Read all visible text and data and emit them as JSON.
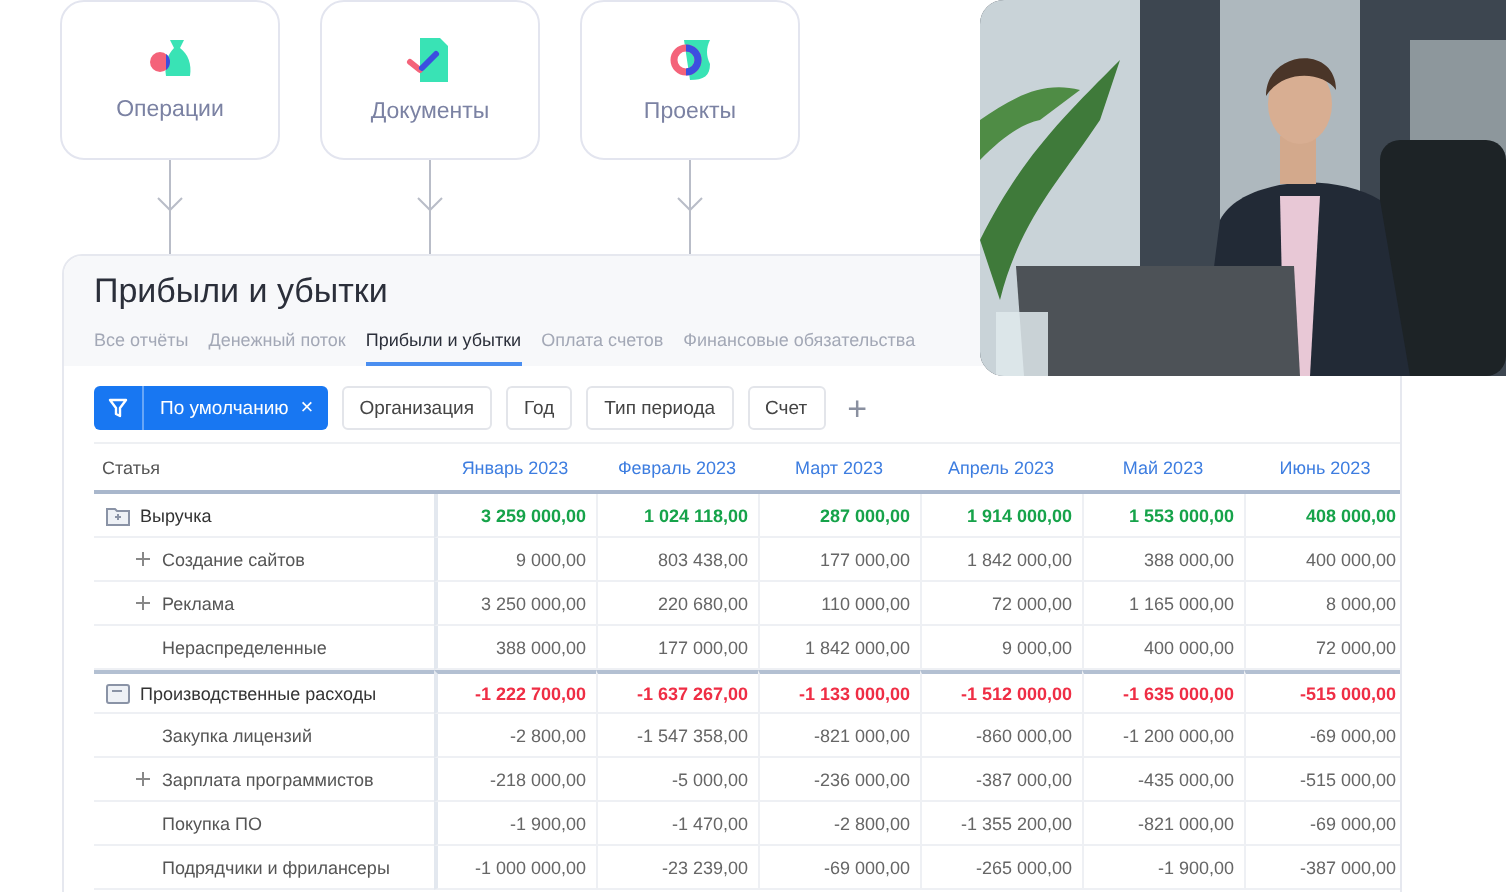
{
  "modules": [
    {
      "label": "Операции",
      "kind": "operations"
    },
    {
      "label": "Документы",
      "kind": "documents"
    },
    {
      "label": "Проекты",
      "kind": "projects"
    }
  ],
  "report": {
    "title": "Прибыли и убытки",
    "tabs": [
      {
        "label": "Все отчёты",
        "selected": false
      },
      {
        "label": "Денежный поток",
        "selected": false
      },
      {
        "label": "Прибыли и убытки",
        "selected": true
      },
      {
        "label": "Оплата счетов",
        "selected": false
      },
      {
        "label": "Финансовые обязательства",
        "selected": false
      }
    ],
    "filters": {
      "active": {
        "label": "По умолчанию",
        "remove": "×"
      },
      "chips": [
        "Организация",
        "Год",
        "Тип периода",
        "Счет"
      ],
      "add": "+"
    },
    "table": {
      "columns": [
        "Статья",
        "Январь 2023",
        "Февраль 2023",
        "Март 2023",
        "Апрель 2023",
        "Май 2023",
        "Июнь 2023"
      ],
      "rows": [
        {
          "kind": "income",
          "name": "Выручка",
          "values": [
            "3 259 000,00",
            "1 024 118,00",
            "287 000,00",
            "1 914 000,00",
            "1 553 000,00",
            "408 000,00"
          ]
        },
        {
          "kind": "item",
          "expandable": true,
          "name": "Создание сайтов",
          "values": [
            "9 000,00",
            "803 438,00",
            "177 000,00",
            "1 842 000,00",
            "388 000,00",
            "400 000,00"
          ]
        },
        {
          "kind": "item",
          "expandable": true,
          "name": "Реклама",
          "values": [
            "3 250 000,00",
            "220 680,00",
            "110 000,00",
            "72 000,00",
            "1 165 000,00",
            "8 000,00"
          ]
        },
        {
          "kind": "item",
          "expandable": false,
          "name": "Нераспределенные",
          "values": [
            "388 000,00",
            "177 000,00",
            "1 842 000,00",
            "9 000,00",
            "400 000,00",
            "72 000,00"
          ]
        },
        {
          "kind": "expense",
          "name": "Производственные расходы",
          "values": [
            "-1 222 700,00",
            "-1 637 267,00",
            "-1 133 000,00",
            "-1 512 000,00",
            "-1 635 000,00",
            "-515 000,00"
          ]
        },
        {
          "kind": "item",
          "expandable": false,
          "name": "Закупка лицензий",
          "values": [
            "-2 800,00",
            "-1 547 358,00",
            "-821 000,00",
            "-860 000,00",
            "-1 200 000,00",
            "-69 000,00"
          ]
        },
        {
          "kind": "item",
          "expandable": true,
          "name": "Зарплата программистов",
          "values": [
            "-218 000,00",
            "-5 000,00",
            "-236 000,00",
            "-387 000,00",
            "-435 000,00",
            "-515 000,00"
          ]
        },
        {
          "kind": "item",
          "expandable": false,
          "name": "Покупка ПО",
          "values": [
            "-1 900,00",
            "-1 470,00",
            "-2 800,00",
            "-1 355 200,00",
            "-821 000,00",
            "-69 000,00"
          ]
        },
        {
          "kind": "item",
          "expandable": false,
          "name": "Подрядчики и фрилансеры",
          "values": [
            "-1 000 000,00",
            "-23 239,00",
            "-69 000,00",
            "-265 000,00",
            "-1 900,00",
            "-387 000,00"
          ]
        }
      ]
    }
  }
}
